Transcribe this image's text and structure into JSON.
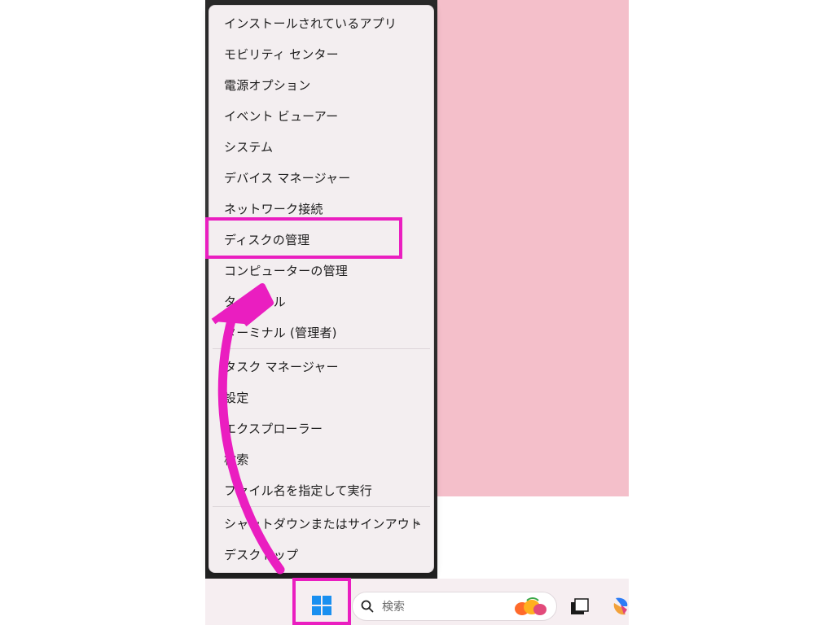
{
  "context_menu": {
    "items": [
      {
        "label": "インストールされているアプリ"
      },
      {
        "label": "モビリティ センター"
      },
      {
        "label": "電源オプション"
      },
      {
        "label": "イベント ビューアー"
      },
      {
        "label": "システム"
      },
      {
        "label": "デバイス マネージャー"
      },
      {
        "label": "ネットワーク接続"
      },
      {
        "label": "ディスクの管理"
      },
      {
        "label": "コンピューターの管理"
      },
      {
        "label": "ターミナル"
      },
      {
        "label": "ターミナル (管理者)"
      },
      {
        "label": "タスク マネージャー"
      },
      {
        "label": "設定"
      },
      {
        "label": "エクスプローラー"
      },
      {
        "label": "検索"
      },
      {
        "label": "ファイル名を指定して実行"
      },
      {
        "label": "シャットダウンまたはサインアウト",
        "submenu_arrow": "›"
      },
      {
        "label": "デスクトップ"
      }
    ]
  },
  "taskbar": {
    "search_label": "検索"
  },
  "colors": {
    "annotation": "#ea1ec0",
    "wallpaper": "#f4bfca",
    "menu_bg": "#f3eef0",
    "start_blue": "#1a8ff0"
  }
}
